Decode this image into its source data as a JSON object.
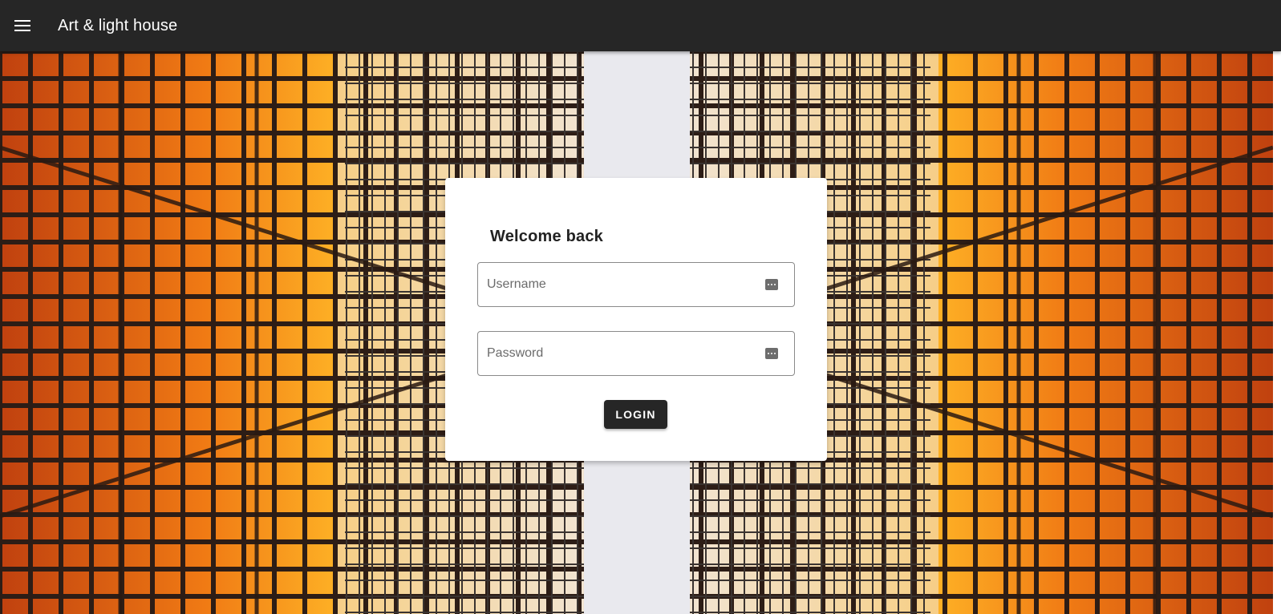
{
  "header": {
    "title": "Art & light house",
    "menu_icon": "menu-icon"
  },
  "login": {
    "heading": "Welcome back",
    "username_placeholder": "Username",
    "username_value": "",
    "password_placeholder": "Password",
    "password_value": "",
    "field_icon": "password-dots-icon",
    "button_label": "LOGIN"
  },
  "colors": {
    "appbar": "#262626",
    "button": "#262626",
    "accent_orange": "#f0901e"
  }
}
